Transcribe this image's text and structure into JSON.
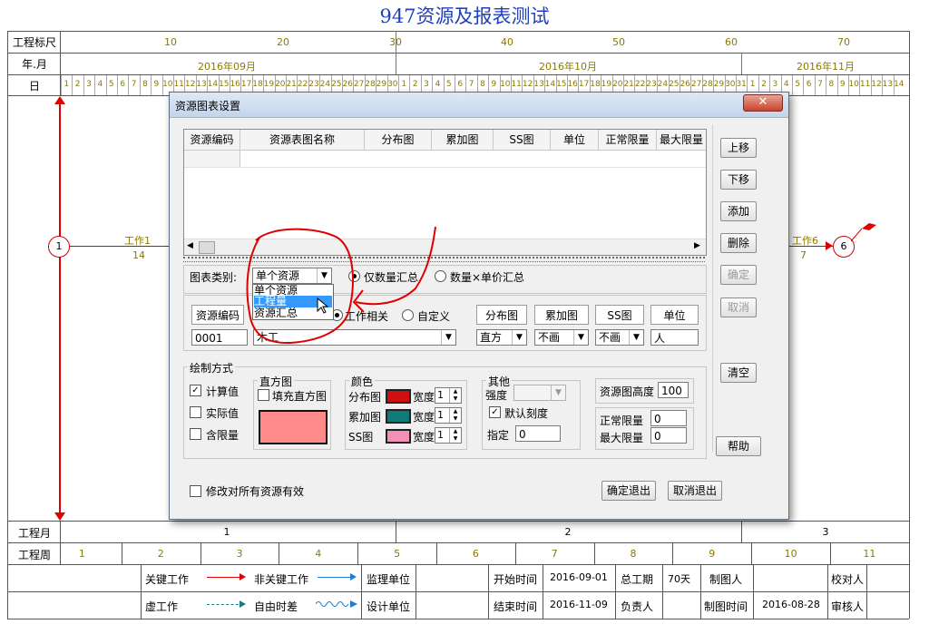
{
  "sheet": {
    "title": "947资源及报表测试",
    "row_labels": {
      "scale": "工程标尺",
      "yearmonth": "年.月",
      "day": "日",
      "month": "工程月",
      "week": "工程周"
    },
    "scale_numbers": [
      "10",
      "20",
      "30",
      "40",
      "50",
      "60",
      "70"
    ],
    "months": [
      "2016年09月",
      "2016年10月",
      "2016年11月"
    ],
    "days_sep": [
      "1",
      "2",
      "3",
      "4",
      "5",
      "6",
      "7",
      "8",
      "9",
      "10",
      "11",
      "12",
      "13",
      "14",
      "15",
      "16",
      "17",
      "18",
      "19",
      "20",
      "21",
      "22",
      "23",
      "24",
      "25",
      "26",
      "27",
      "28",
      "29",
      "30"
    ],
    "days_oct": [
      "1",
      "2",
      "3",
      "4",
      "5",
      "6",
      "7",
      "8",
      "9",
      "10",
      "11",
      "12",
      "13",
      "14",
      "15",
      "16",
      "17",
      "18",
      "19",
      "20",
      "21",
      "22",
      "23",
      "24",
      "25",
      "26",
      "27",
      "28",
      "29",
      "30",
      "31"
    ],
    "days_nov": [
      "1",
      "2",
      "3",
      "4",
      "5",
      "6",
      "7",
      "8",
      "9",
      "10",
      "11",
      "12",
      "13",
      "14"
    ],
    "project_months": [
      "1",
      "2",
      "3"
    ],
    "project_weeks": [
      "1",
      "2",
      "3",
      "4",
      "5",
      "6",
      "7",
      "8",
      "9",
      "10",
      "11"
    ],
    "node1": "1",
    "node6": "6",
    "task1": {
      "name": "工作1",
      "duration": "14"
    },
    "task6": {
      "name": "工作6",
      "duration": "7"
    },
    "legend": {
      "critical": "关键工作",
      "noncritical": "非关键工作",
      "virtual": "虚工作",
      "free_float": "自由时差",
      "supervisor": "监理单位",
      "designer": "设计单位",
      "start_label": "开始时间",
      "start_value": "2016-09-01",
      "end_label": "结束时间",
      "end_value": "2016-11-09",
      "total_label": "总工期",
      "total_value": "70天",
      "owner_label": "负责人",
      "maker_label": "制图人",
      "maketime_label": "制图时间",
      "maketime_value": "2016-08-28",
      "checker_label": "校对人",
      "auditor_label": "审核人"
    }
  },
  "dialog": {
    "title": "资源图表设置",
    "close_icon": "close-icon",
    "table_headers": [
      "资源编码",
      "资源表图名称",
      "分布图",
      "累加图",
      "SS图",
      "单位",
      "正常限量",
      "最大限量"
    ],
    "side_buttons": {
      "up": "上移",
      "down": "下移",
      "add": "添加",
      "delete": "删除",
      "confirm": "确定",
      "cancel": "取消",
      "clear": "清空",
      "help": "帮助"
    },
    "chart_type_label": "图表类别:",
    "chart_type_value": "单个资源",
    "chart_type_options": [
      "单个资源",
      "工程量",
      "资源汇总"
    ],
    "radio_qty": "仅数量汇总",
    "radio_qty_price": "数量×单价汇总",
    "radio_work": "工作相关",
    "radio_custom": "自定义",
    "resource_code_header": "资源编码",
    "resource_code_value": "0001",
    "resource_name_value": "木工",
    "dist_header": "分布图",
    "dist_value": "直方",
    "accum_header": "累加图",
    "accum_value": "不画",
    "ss_header": "SS图",
    "ss_value": "不画",
    "unit_header": "单位",
    "unit_value": "人",
    "draw_group": "绘制方式",
    "draw_calc": "计算值",
    "draw_actual": "实际值",
    "draw_limit": "含限量",
    "hist_group": "直方图",
    "hist_fill": "填充直方图",
    "color_group": "颜色",
    "color_dist": "分布图",
    "color_accum": "累加图",
    "color_ss": "SS图",
    "width_label": "宽度",
    "width_dist": "1",
    "width_accum": "1",
    "width_ss": "1",
    "colors": {
      "dist": "#d01010",
      "accum": "#0e7a7a",
      "ss": "#f48fb5",
      "hist_fill": "#ff8a8a"
    },
    "other_group": "其他",
    "strength_label": "强度",
    "default_scale": "默认刻度",
    "specify_label": "指定",
    "specify_value": "0",
    "height_label": "资源图高度",
    "height_value": "100",
    "normal_limit_label": "正常限量",
    "normal_limit_value": "0",
    "max_limit_label": "最大限量",
    "max_limit_value": "0",
    "apply_all": "修改对所有资源有效",
    "ok_exit": "确定退出",
    "cancel_exit": "取消退出"
  }
}
